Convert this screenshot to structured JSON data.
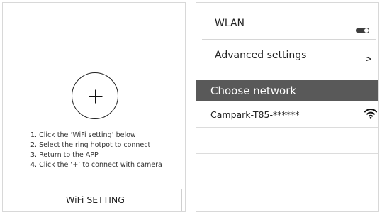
{
  "left_panel": {
    "add_button_symbol": "+",
    "instructions": [
      "1. Click the ‘WiFi setting’ below",
      "2. Select the ring hotpot to connect",
      "3. Return to the APP",
      "4. Click the ‘+’ to connect with camera"
    ],
    "wifi_setting_button_label": "WiFi SETTING"
  },
  "right_panel": {
    "wlan": {
      "label": "WLAN",
      "toggle_state": "on"
    },
    "advanced_settings": {
      "label": "Advanced settings",
      "chevron": ">"
    },
    "section_header": "Choose network",
    "networks": [
      {
        "name": "Campark-T85-******",
        "icon": "wifi-signal-icon"
      }
    ]
  },
  "colors": {
    "header_bg": "#595959",
    "header_text": "#ffffff",
    "border": "#d8d8d8",
    "text": "#222222"
  }
}
